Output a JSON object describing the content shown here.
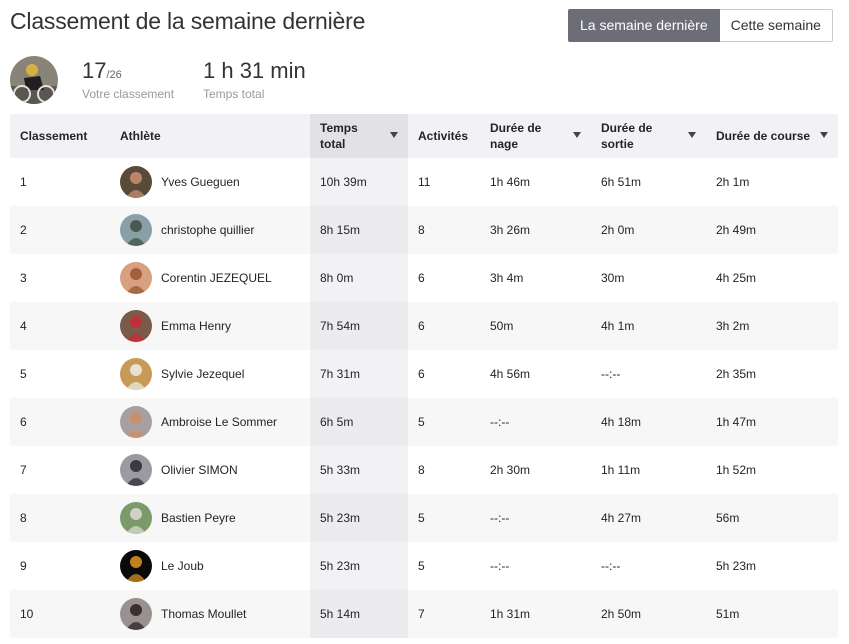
{
  "header": {
    "title": "Classement de la semaine dernière",
    "toggle": {
      "last_week": "La semaine dernière",
      "this_week": "Cette semaine"
    }
  },
  "summary": {
    "rank": "17",
    "rank_total": "/26",
    "rank_label": "Votre classement",
    "total_time": "1 h 31 min",
    "total_time_label": "Temps total"
  },
  "columns": [
    {
      "label": "Classement"
    },
    {
      "label": "Athlète"
    },
    {
      "label": "Temps total"
    },
    {
      "label": "Activités"
    },
    {
      "label": "Durée de nage"
    },
    {
      "label": "Durée de sortie"
    },
    {
      "label": "Durée de course"
    }
  ],
  "rows": [
    {
      "rank": "1",
      "name": "Yves Gueguen",
      "total": "10h 39m",
      "activities": "11",
      "swim": "1h 46m",
      "ride": "6h 51m",
      "run": "2h 1m",
      "avatar_bg": "#5a4a3a",
      "avatar_fg": "#b8876a"
    },
    {
      "rank": "2",
      "name": "christophe quillier",
      "total": "8h 15m",
      "activities": "8",
      "swim": "3h 26m",
      "ride": "2h 0m",
      "run": "2h 49m",
      "avatar_bg": "#8aa0a8",
      "avatar_fg": "#4a5a50"
    },
    {
      "rank": "3",
      "name": "Corentin JEZEQUEL",
      "total": "8h 0m",
      "activities": "6",
      "swim": "3h 4m",
      "ride": "30m",
      "run": "4h 25m",
      "avatar_bg": "#d8a080",
      "avatar_fg": "#a0603a"
    },
    {
      "rank": "4",
      "name": "Emma Henry",
      "total": "7h 54m",
      "activities": "6",
      "swim": "50m",
      "ride": "4h 1m",
      "run": "3h 2m",
      "avatar_bg": "#7a5a48",
      "avatar_fg": "#c0303a"
    },
    {
      "rank": "5",
      "name": "Sylvie Jezequel",
      "total": "7h 31m",
      "activities": "6",
      "swim": "4h 56m",
      "ride": "--:--",
      "run": "2h 35m",
      "avatar_bg": "#c89a58",
      "avatar_fg": "#e8e0d0"
    },
    {
      "rank": "6",
      "name": "Ambroise Le Sommer",
      "total": "6h 5m",
      "activities": "5",
      "swim": "--:--",
      "ride": "4h 18m",
      "run": "1h 47m",
      "avatar_bg": "#a8a0a0",
      "avatar_fg": "#c89070"
    },
    {
      "rank": "7",
      "name": "Olivier SIMON",
      "total": "5h 33m",
      "activities": "8",
      "swim": "2h 30m",
      "ride": "1h 11m",
      "run": "1h 52m",
      "avatar_bg": "#9a9aa0",
      "avatar_fg": "#3a3a40"
    },
    {
      "rank": "8",
      "name": "Bastien Peyre",
      "total": "5h 23m",
      "activities": "5",
      "swim": "--:--",
      "ride": "4h 27m",
      "run": "56m",
      "avatar_bg": "#7a9a6a",
      "avatar_fg": "#d0d0c8"
    },
    {
      "rank": "9",
      "name": "Le Joub",
      "total": "5h 23m",
      "activities": "5",
      "swim": "--:--",
      "ride": "--:--",
      "run": "5h 23m",
      "avatar_bg": "#0a0a0a",
      "avatar_fg": "#c08020"
    },
    {
      "rank": "10",
      "name": "Thomas Moullet",
      "total": "5h 14m",
      "activities": "7",
      "swim": "1h 31m",
      "ride": "2h 50m",
      "run": "51m",
      "avatar_bg": "#9a9090",
      "avatar_fg": "#3a3030"
    }
  ]
}
